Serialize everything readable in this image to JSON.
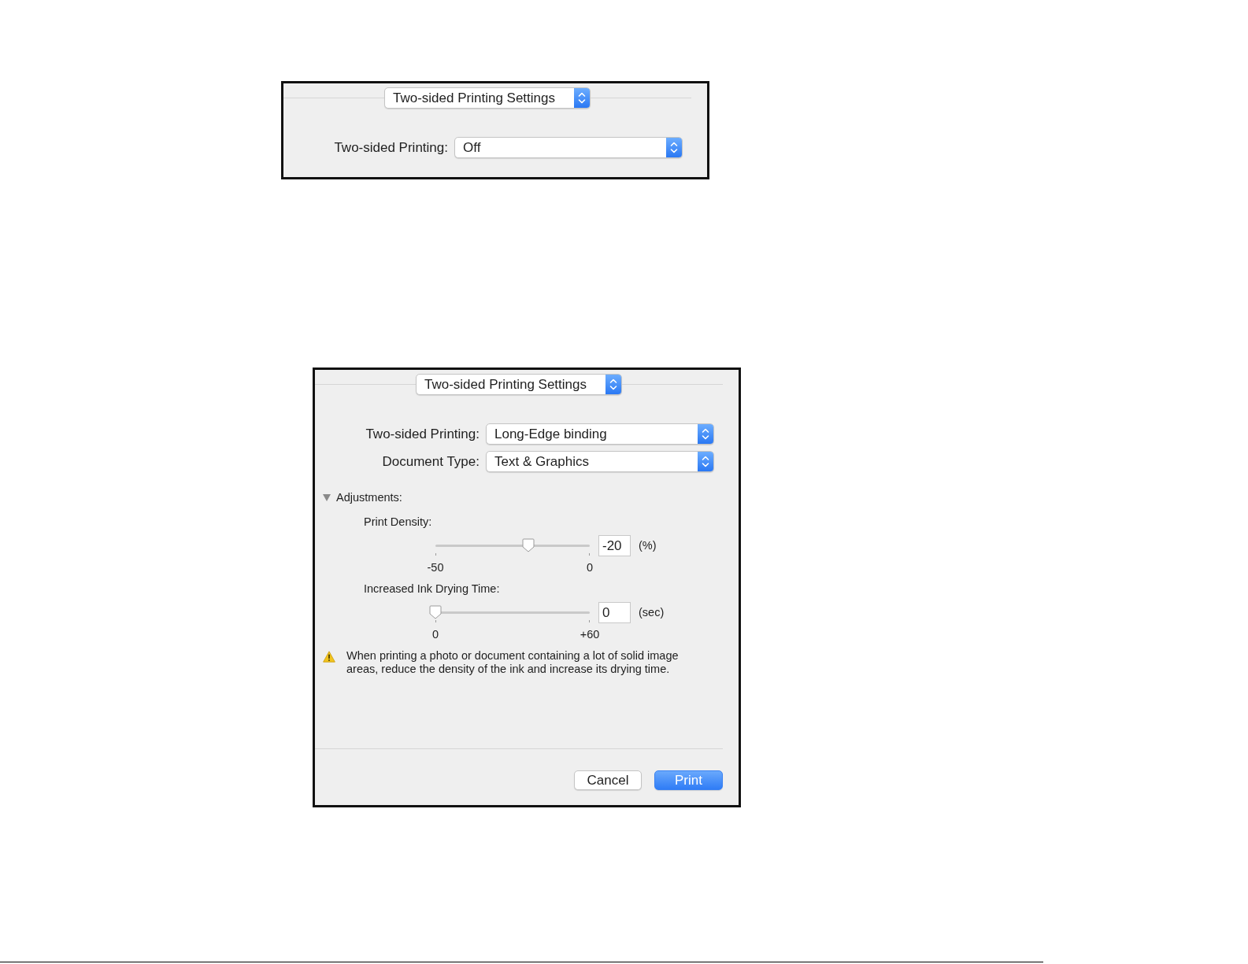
{
  "panels": [
    {
      "header_popup": "Two-sided Printing Settings",
      "fields": [
        {
          "label": "Two-sided Printing:",
          "value": "Off"
        }
      ]
    },
    {
      "header_popup": "Two-sided Printing Settings",
      "fields": [
        {
          "label": "Two-sided Printing:",
          "value": "Long-Edge binding"
        },
        {
          "label": "Document Type:",
          "value": "Text & Graphics"
        }
      ],
      "adjustments": {
        "label": "Adjustments:",
        "expanded": true,
        "sliders": [
          {
            "label": "Print Density:",
            "level": 0.6,
            "value": "-20",
            "unit": "(%)",
            "min_label": "-50",
            "max_label": "0"
          },
          {
            "label": "Increased Ink Drying Time:",
            "level": 0,
            "value": "0",
            "unit": "(sec)",
            "min_label": "0",
            "max_label": "+60"
          }
        ]
      },
      "warning": "When printing a photo or document containing a lot of solid image areas, reduce the density of the ink and increase its drying time.",
      "buttons": [
        {
          "label": "Cancel",
          "kind": "secondary"
        },
        {
          "label": "Print",
          "kind": "default"
        }
      ]
    }
  ]
}
